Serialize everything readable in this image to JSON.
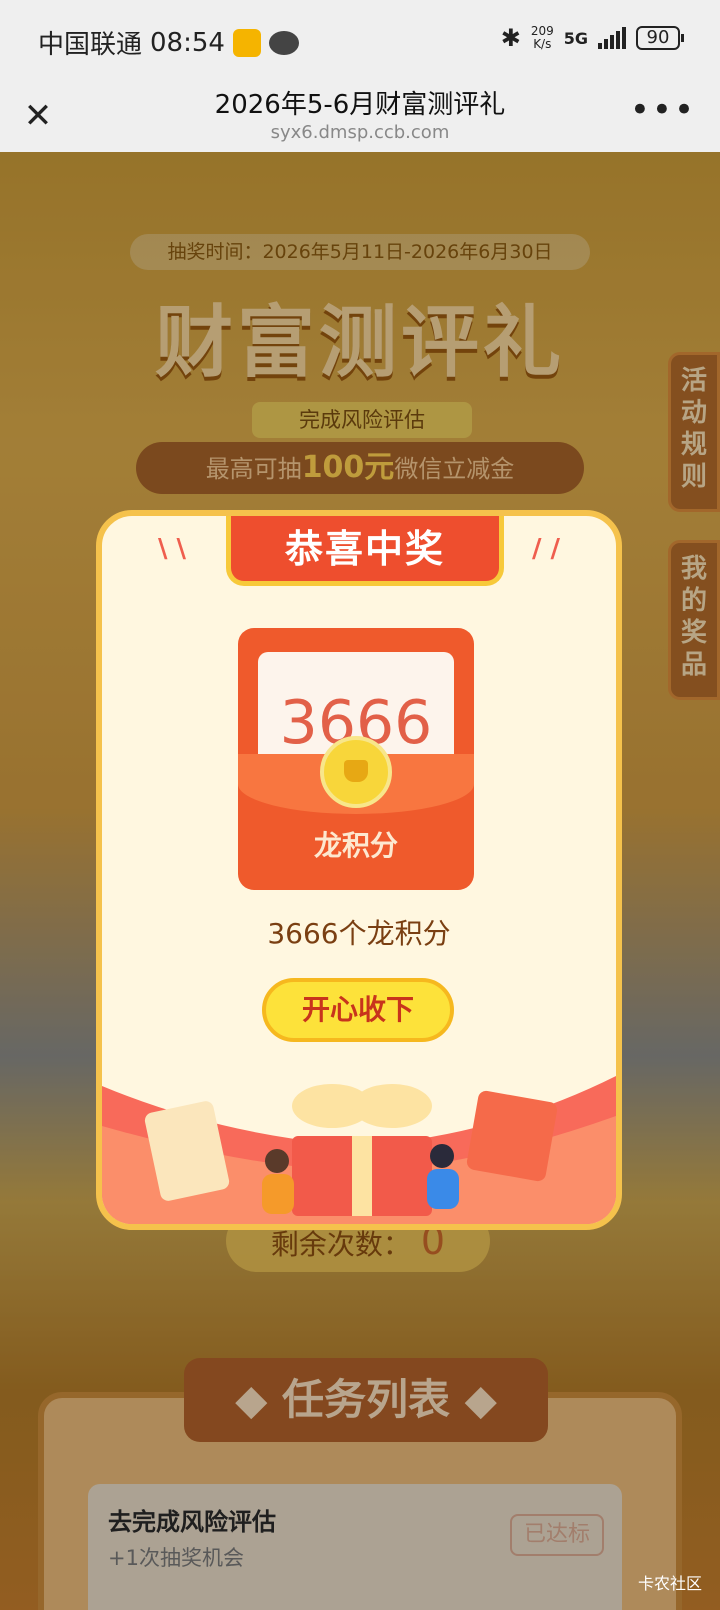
{
  "status_bar": {
    "carrier": "中国联通",
    "time": "08:54",
    "net_speed_value": "209",
    "net_speed_unit": "K/s",
    "network": "5G",
    "battery": "90"
  },
  "title_bar": {
    "title": "2026年5-6月财富测评礼",
    "url": "syx6.dmsp.ccb.com",
    "close_icon": "close-icon",
    "more_icon": "more-icon"
  },
  "page": {
    "draw_time": "抽奖时间：2026年5月11日-2026年6月30日",
    "banner_title": "财富测评礼",
    "subtitle_tag": "完成风险评估",
    "prize_banner_prefix": "最高可抽",
    "prize_banner_amount": "100元",
    "prize_banner_suffix": "微信立减金",
    "side_rules": "活动规则",
    "side_prizes": "我的奖品",
    "remaining_label": "剩余次数：",
    "remaining_count": "0",
    "task_panel_title": "◆ 任务列表 ◆",
    "task": {
      "name": "去完成风险评估",
      "reward": "+1次抽奖机会",
      "status": "已达标"
    },
    "watermark": "卡农社区"
  },
  "modal": {
    "badge": "恭喜中奖",
    "prize_card_amount": "3666",
    "prize_card_label": "龙积分",
    "prize_desc": "3666个龙积分",
    "accept_button": "开心收下"
  },
  "colors": {
    "accent_red": "#ee4e2e",
    "accent_gold": "#f5c24c",
    "button_yellow": "#fde23a",
    "text_brown": "#7a3f12"
  }
}
